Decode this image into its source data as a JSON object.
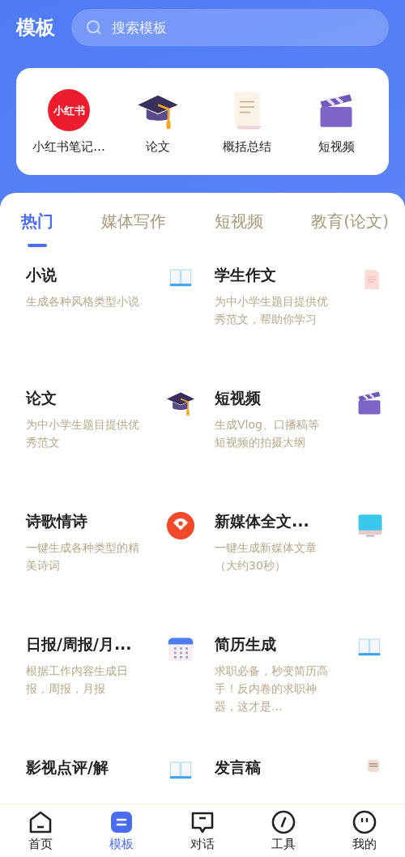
{
  "header": {
    "title": "模板",
    "search": {
      "placeholder": "搜索模板"
    }
  },
  "quick_items": [
    {
      "label": "小红书笔记...",
      "logo_text": "小红书"
    },
    {
      "label": "论文"
    },
    {
      "label": "概括总结"
    },
    {
      "label": "短视频"
    }
  ],
  "tabs": [
    {
      "label": "热门",
      "selected": true
    },
    {
      "label": "媒体写作",
      "selected": false
    },
    {
      "label": "短视频",
      "selected": false
    },
    {
      "label": "教育(论文)",
      "selected": false
    }
  ],
  "templates": [
    {
      "title": "小说",
      "description": "生成各种风格类型小说"
    },
    {
      "title": "学生作文",
      "description": "为中小学生题目提供优秀范文，帮助你学习"
    },
    {
      "title": "论文",
      "description": "为中小学生题目提供优秀范文"
    },
    {
      "title": "短视频",
      "description": "生成Vlog、口播稿等短视频的拍摄大纲"
    },
    {
      "title": "诗歌情诗",
      "description": "一键生成各种类型的精美诗词"
    },
    {
      "title": "新媒体全文...",
      "description": "一键生成新媒体文章（大约30秒）"
    },
    {
      "title": "日报/周报/月...",
      "description": "根据工作内容生成日报，周报，月报"
    },
    {
      "title": "简历生成",
      "description": "求职必备，秒变简历高手！反内卷的求职神器，这才是..."
    },
    {
      "title": "影视点评/解"
    },
    {
      "title": "发言稿"
    }
  ],
  "nav": [
    {
      "label": "首页",
      "selected": false
    },
    {
      "label": "模板",
      "selected": true
    },
    {
      "label": "对话",
      "selected": false
    },
    {
      "label": "工具",
      "selected": false
    },
    {
      "label": "我的",
      "selected": false
    }
  ]
}
